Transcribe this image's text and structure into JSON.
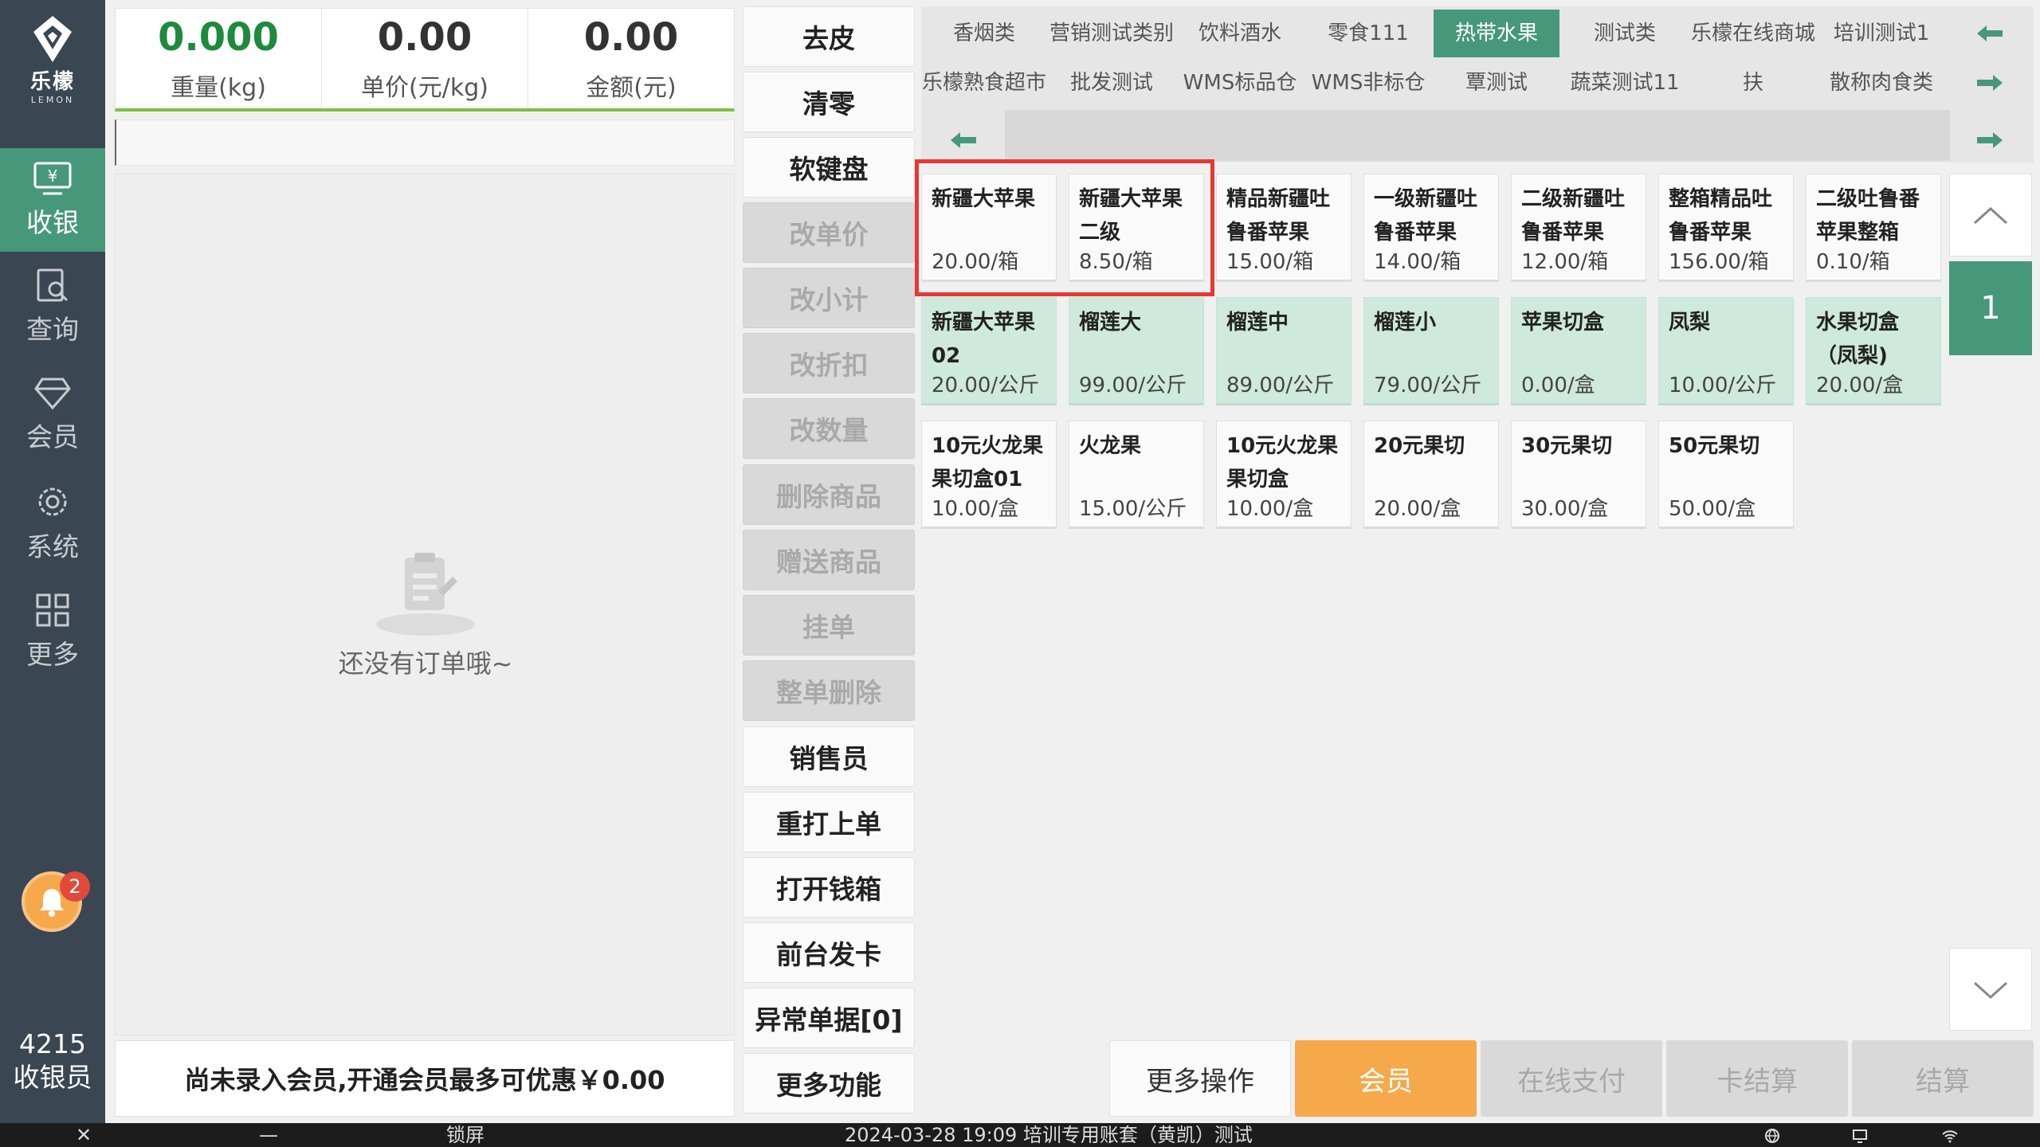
{
  "app": {
    "logo_cn": "乐檬",
    "logo_en": "LEMON"
  },
  "nav": {
    "items": [
      {
        "label": "收银",
        "icon": "cash-register-icon",
        "active": true
      },
      {
        "label": "查询",
        "icon": "search-document-icon",
        "active": false
      },
      {
        "label": "会员",
        "icon": "diamond-icon",
        "active": false
      },
      {
        "label": "系统",
        "icon": "gear-icon",
        "active": false
      },
      {
        "label": "更多",
        "icon": "grid-icon",
        "active": false
      }
    ],
    "notification_count": "2",
    "cashier_id": "4215",
    "cashier_role": "收银员"
  },
  "scale": {
    "weight_value": "0.000",
    "weight_label": "重量(kg)",
    "unit_price_value": "0.00",
    "unit_price_label": "单价(元/kg)",
    "amount_value": "0.00",
    "amount_label": "金额(元)"
  },
  "barcode_input": {
    "value": ""
  },
  "order": {
    "empty_text": "还没有订单哦~",
    "member_notice": "尚未录入会员,开通会员最多可优惠￥0.00"
  },
  "functions": [
    {
      "label": "去皮",
      "enabled": true
    },
    {
      "label": "清零",
      "enabled": true
    },
    {
      "label": "软键盘",
      "enabled": true
    },
    {
      "label": "改单价",
      "enabled": false
    },
    {
      "label": "改小计",
      "enabled": false
    },
    {
      "label": "改折扣",
      "enabled": false
    },
    {
      "label": "改数量",
      "enabled": false
    },
    {
      "label": "删除商品",
      "enabled": false
    },
    {
      "label": "赠送商品",
      "enabled": false
    },
    {
      "label": "挂单",
      "enabled": false
    },
    {
      "label": "整单删除",
      "enabled": false
    },
    {
      "label": "销售员",
      "enabled": true
    },
    {
      "label": "重打上单",
      "enabled": true
    },
    {
      "label": "打开钱箱",
      "enabled": true
    },
    {
      "label": "前台发卡",
      "enabled": true
    },
    {
      "label": "异常单据[0]",
      "enabled": true
    },
    {
      "label": "更多功能",
      "enabled": true
    }
  ],
  "categories": {
    "row1": [
      "香烟类",
      "营销测试类别",
      "饮料酒水",
      "零食111",
      "热带水果",
      "测试类",
      "乐檬在线商城",
      "培训测试1"
    ],
    "row2": [
      "乐檬熟食超市",
      "批发测试",
      "WMS标品仓",
      "WMS非标仓",
      "覃测试",
      "蔬菜测试11",
      "扶",
      "散称肉食类"
    ],
    "active": "热带水果"
  },
  "products": [
    {
      "name": "新疆大苹果",
      "price": "20.00/箱",
      "style": "white"
    },
    {
      "name": "新疆大苹果二级",
      "price": "8.50/箱",
      "style": "white"
    },
    {
      "name": "精品新疆吐鲁番苹果",
      "price": "15.00/箱",
      "style": "white"
    },
    {
      "name": "一级新疆吐鲁番苹果",
      "price": "14.00/箱",
      "style": "white"
    },
    {
      "name": "二级新疆吐鲁番苹果",
      "price": "12.00/箱",
      "style": "white"
    },
    {
      "name": "整箱精品吐鲁番苹果",
      "price": "156.00/箱",
      "style": "white"
    },
    {
      "name": "二级吐鲁番苹果整箱",
      "price": "0.10/箱",
      "style": "white"
    },
    {
      "name": "新疆大苹果02",
      "price": "20.00/公斤",
      "style": "green"
    },
    {
      "name": "榴莲大",
      "price": "99.00/公斤",
      "style": "green"
    },
    {
      "name": "榴莲中",
      "price": "89.00/公斤",
      "style": "green"
    },
    {
      "name": "榴莲小",
      "price": "79.00/公斤",
      "style": "green"
    },
    {
      "name": "苹果切盒",
      "price": "0.00/盒",
      "style": "green"
    },
    {
      "name": "凤梨",
      "price": "10.00/公斤",
      "style": "green"
    },
    {
      "name": "水果切盒（凤梨)",
      "price": "20.00/盒",
      "style": "green"
    },
    {
      "name": "10元火龙果果切盒01",
      "price": "10.00/盒",
      "style": "white"
    },
    {
      "name": "火龙果",
      "price": "15.00/公斤",
      "style": "white"
    },
    {
      "name": "10元火龙果果切盒",
      "price": "10.00/盒",
      "style": "white"
    },
    {
      "name": "20元果切",
      "price": "20.00/盒",
      "style": "white"
    },
    {
      "name": "30元果切",
      "price": "30.00/盒",
      "style": "white"
    },
    {
      "name": "50元果切",
      "price": "50.00/盒",
      "style": "white"
    }
  ],
  "page_number": "1",
  "actions": {
    "more_ops": "更多操作",
    "member": "会员",
    "online_pay": "在线支付",
    "card_settle": "卡结算",
    "settle": "结算"
  },
  "taskbar": {
    "close": "✕",
    "minimize": "—",
    "lock": "锁屏",
    "status": "2024-03-28 19:09 培训专用账套（黄凯）测试"
  },
  "colors": {
    "sidebar": "#3a4652",
    "accent_green": "#47987a",
    "tile_green": "#cfe9dc",
    "member_orange": "#f5a94b",
    "highlight_red": "#e53935"
  }
}
